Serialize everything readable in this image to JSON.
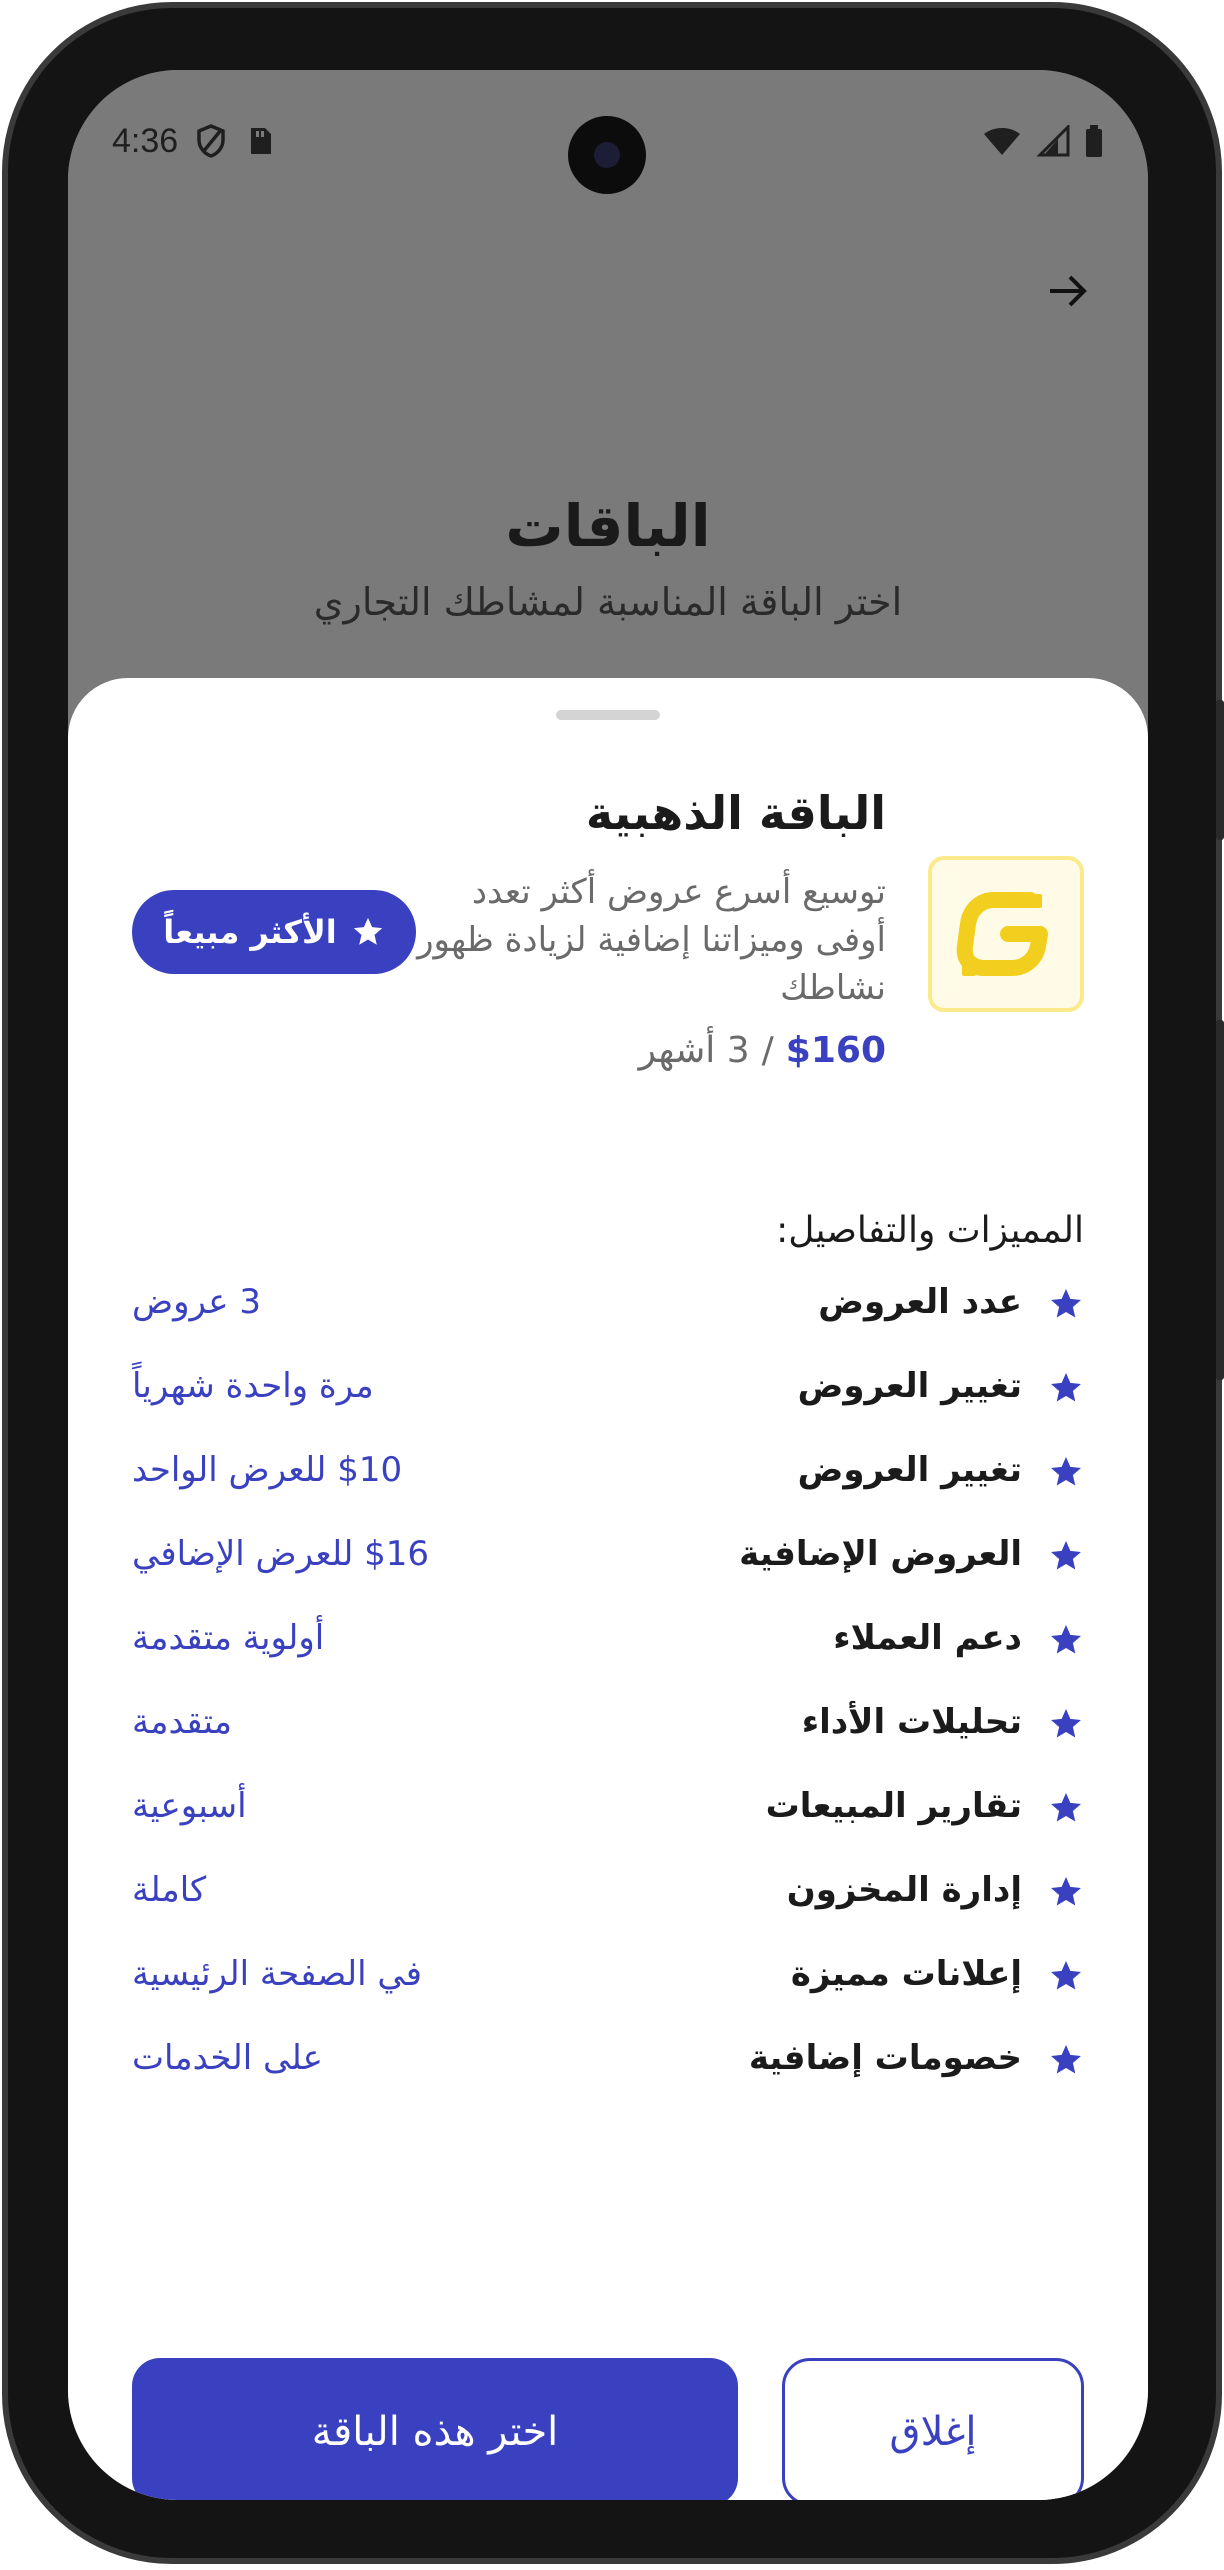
{
  "status_bar": {
    "time": "4:36",
    "icons_left": [
      "shield-icon",
      "sim-card-icon"
    ],
    "icons_right": [
      "wifi-icon",
      "signal-icon",
      "battery-icon"
    ]
  },
  "background_page": {
    "title": "الباقات",
    "subtitle": "اختر الباقة المناسبة لمشاطك التجاري",
    "back_icon": "arrow-right-icon"
  },
  "sheet": {
    "plan": {
      "title": "الباقة الذهبية",
      "description": "توسيع أسرع عروض أكثر تعدد أوفى وميزاتنا إضافية لزيادة ظهور نشاطك",
      "price": "$160",
      "separator": "/",
      "period": "3 أشهر",
      "logo_icon": "gold-plan-logo-icon"
    },
    "badge": {
      "label": "الأكثر مبيعاً",
      "icon": "star-icon"
    },
    "features_heading": "المميزات والتفاصيل:",
    "features": [
      {
        "name": "عدد العروض",
        "value": "3 عروض"
      },
      {
        "name": "تغيير العروض",
        "value": "مرة واحدة شهرياً"
      },
      {
        "name": "تغيير العروض",
        "value": "$10 للعرض الواحد"
      },
      {
        "name": "العروض الإضافية",
        "value": "$16 للعرض الإضافي"
      },
      {
        "name": "دعم العملاء",
        "value": "أولوية متقدمة"
      },
      {
        "name": "تحليلات الأداء",
        "value": "متقدمة"
      },
      {
        "name": "تقارير المبيعات",
        "value": "أسبوعية"
      },
      {
        "name": "إدارة المخزون",
        "value": "كاملة"
      },
      {
        "name": "إعلانات مميزة",
        "value": "في الصفحة الرئيسية"
      },
      {
        "name": "خصومات إضافية",
        "value": "على الخدمات"
      }
    ],
    "buttons": {
      "choose": "اختر هذه الباقة",
      "close": "إغلاق"
    }
  },
  "colors": {
    "accent": "#3a41c0",
    "gold": "#f2cf1e",
    "overlay": "#7a7a7a"
  }
}
